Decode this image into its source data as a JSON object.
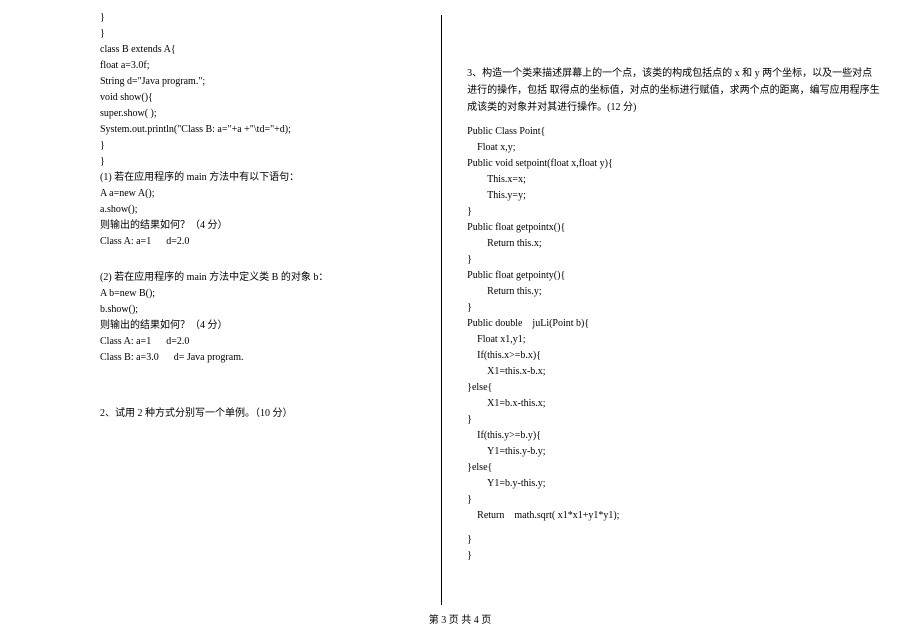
{
  "left": {
    "l1": "}",
    "l2": "}",
    "l3": "class B extends A{",
    "l4": "float a=3.0f;",
    "l5": "String d=\"Java program.\";",
    "l6": "void show(){",
    "l7": "super.show( );",
    "l8": "System.out.println(\"Class B: a=\"+a +\"\\td=\"+d);",
    "l9": "}",
    "l10": "}",
    "l11": "(1) 若在应用程序的 main  方法中有以下语句：",
    "l12": "A a=new A();",
    "l13": "a.show();",
    "l14": "则输出的结果如何？（4 分）",
    "l15": "Class A: a=1      d=2.0",
    "l16": "(2)  若在应用程序的 main  方法中定义类 B  的对象 b：",
    "l17": "A b=new B();",
    "l18": "b.show();",
    "l19": "则输出的结果如何？（4 分）",
    "l20": "Class A: a=1      d=2.0",
    "l21": "Class B: a=3.0      d= Java program.",
    "l22": "2、试用 2 种方式分别写一个单例。（10 分）"
  },
  "right": {
    "r1": "3、构造一个类来描述屏幕上的一个点，该类的构成包括点的 x 和 y 两个坐标，以及一些对点进行的操作，包括  取得点的坐标值，对点的坐标进行赋值，求两个点的距离，编写应用程序生成该类的对象并对其进行操作。(12 分)  ",
    "r2": "Public Class Point{",
    "r3": "Float x,y;",
    "r4": "Public void setpoint(float x,float y){",
    "r5": "This.x=x;",
    "r6": "This.y=y;",
    "r7": "}",
    "r8": "Public float getpointx(){",
    "r9": "Return this.x;",
    "r10": "}",
    "r11": "Public float getpointy(){",
    "r12": "Return this.y;",
    "r13": "}",
    "r14": "Public double    juLi(Point b){",
    "r15": "Float x1,y1;",
    "r16": "If(this.x>=b.x){",
    "r17": "X1=this.x-b.x;",
    "r18": "}else{",
    "r19": "X1=b.x-this.x;",
    "r20": "}",
    "r21": "If(this.y>=b.y){",
    "r22": "Y1=this.y-b.y;",
    "r23": "}else{",
    "r24": "Y1=b.y-this.y;",
    "r25": "}",
    "r26": "Return    math.sqrt( x1*x1+y1*y1);",
    "r27": "}",
    "r28": "}"
  },
  "footer": "第  3  页  共  4  页"
}
